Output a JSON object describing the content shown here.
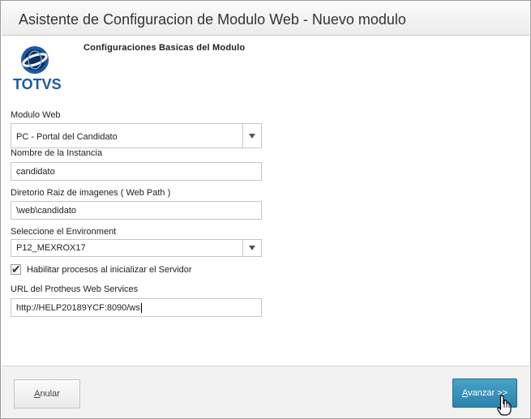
{
  "window": {
    "title": "Asistente de Configuracion de Modulo Web - Nuevo modulo"
  },
  "logo": {
    "text": "TOTVS",
    "colors": {
      "primary": "#1b5aa8",
      "dark": "#0f2f5c"
    }
  },
  "header": {
    "title": "Configuraciones Basicas del Modulo"
  },
  "form": {
    "modulo_web": {
      "label": "Modulo Web",
      "value": "PC - Portal del Candidato"
    },
    "nombre_instancia": {
      "label": "Nombre de la Instancia",
      "value": "candidato"
    },
    "directorio_raiz": {
      "label": "Diretorio Raiz de imagenes ( Web Path )",
      "value": "\\web\\candidato"
    },
    "environment": {
      "label": "Seleccione el Environment",
      "value": "P12_MEXROX17"
    },
    "habilitar_procesos": {
      "label": "Habilitar procesos al inicializar el Servidor",
      "checked": true
    },
    "url_webservices": {
      "label": "URL del Protheus Web Services",
      "value": "http://HELP20189YCF:8090/ws"
    }
  },
  "footer": {
    "cancel": {
      "accesskey": "A",
      "rest": "nular"
    },
    "next": {
      "accesskey": "A",
      "rest": "vanzar >>"
    }
  },
  "colors": {
    "accent": "#2c83ad"
  },
  "icons": {
    "dropdown": "chevron-down-icon",
    "check": "checkmark-icon",
    "cursor": "hand-pointer-icon"
  }
}
